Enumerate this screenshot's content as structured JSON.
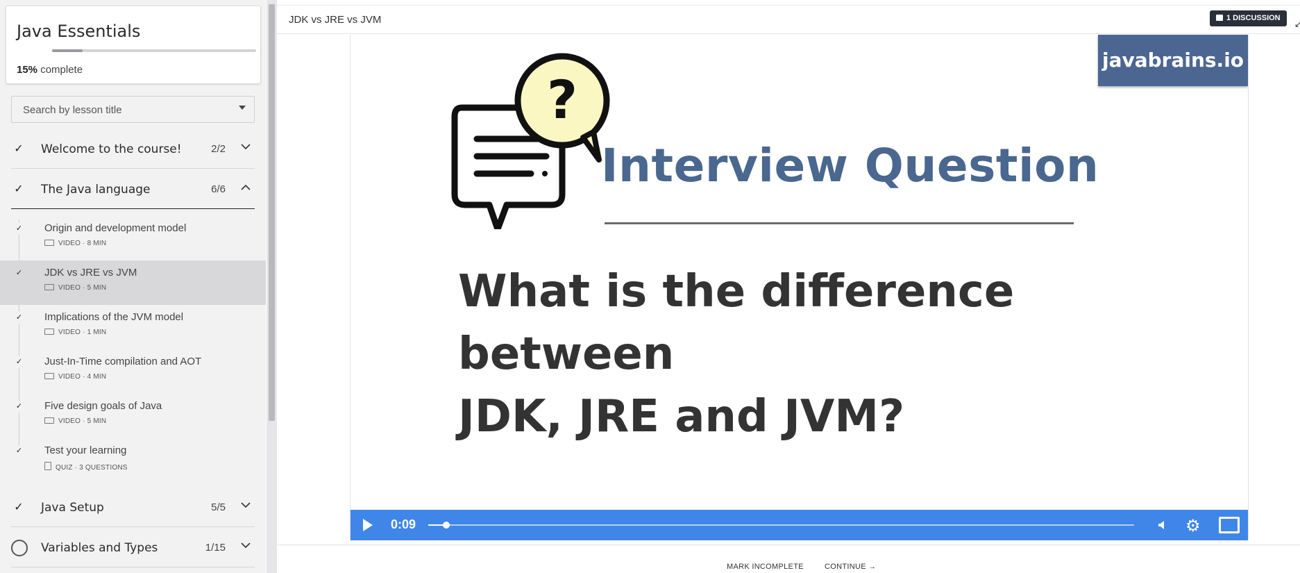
{
  "course": {
    "title": "Java Essentials",
    "progress_value": "15%",
    "progress_suffix": "complete",
    "progress_fraction": 0.15
  },
  "search": {
    "placeholder": "Search by lesson title"
  },
  "sections": [
    {
      "title": "Welcome to the course!",
      "count": "2/2",
      "state": "complete",
      "expanded": false
    },
    {
      "title": "The Java language",
      "count": "6/6",
      "state": "complete",
      "expanded": true
    },
    {
      "title": "Java Setup",
      "count": "5/5",
      "state": "complete",
      "expanded": false
    },
    {
      "title": "Variables and Types",
      "count": "1/15",
      "state": "in-progress",
      "expanded": false
    }
  ],
  "lessons": [
    {
      "title": "Origin and development model",
      "meta": "VIDEO · 8 MIN",
      "icon": "video-icon",
      "active": false
    },
    {
      "title": "JDK vs JRE vs JVM",
      "meta": "VIDEO · 5 MIN",
      "icon": "video-icon",
      "active": true
    },
    {
      "title": "Implications of the JVM model",
      "meta": "VIDEO · 1 MIN",
      "icon": "video-icon",
      "active": false
    },
    {
      "title": "Just-In-Time compilation and AOT",
      "meta": "VIDEO · 4 MIN",
      "icon": "video-icon",
      "active": false
    },
    {
      "title": "Five design goals of Java",
      "meta": "VIDEO · 5 MIN",
      "icon": "video-icon",
      "active": false
    },
    {
      "title": "Test your learning",
      "meta": "QUIZ · 3 QUESTIONS",
      "icon": "quiz-icon",
      "active": false
    }
  ],
  "header": {
    "lesson_title": "JDK vs JRE vs JVM",
    "discussion_label": "1 DISCUSSION"
  },
  "video": {
    "brand": "javabrains.io",
    "heading": "Interview Question",
    "question_line1": "What is the difference between",
    "question_line2": "JDK, JRE and JVM?",
    "time": "0:09",
    "played_fraction": 0.026
  },
  "footer": {
    "mark_label": "MARK INCOMPLETE",
    "continue_label": "CONTINUE →"
  },
  "colors": {
    "accent": "#3f86e8",
    "brand_bg": "#4b6690",
    "heading": "#4a678f",
    "discussion_bg": "#2b2f3b"
  }
}
